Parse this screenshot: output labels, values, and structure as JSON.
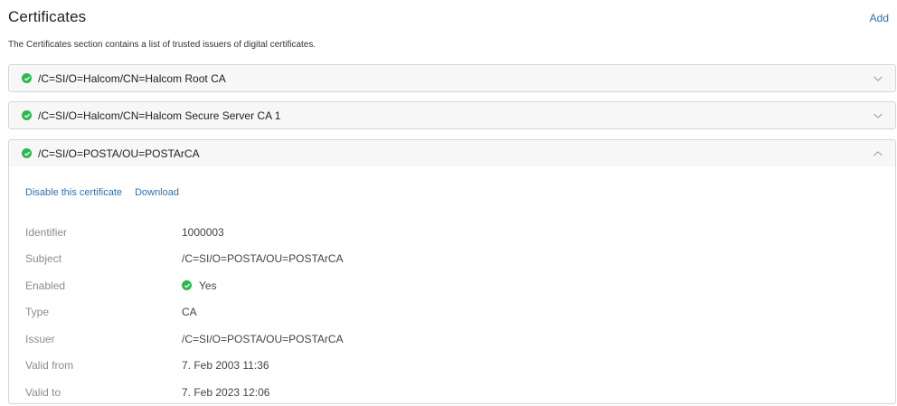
{
  "header": {
    "title": "Certificates",
    "add_label": "Add"
  },
  "description": "The Certificates section contains a list of trusted issuers of digital certificates.",
  "certificates": [
    {
      "name": "/C=SI/O=Halcom/CN=Halcom Root CA",
      "expanded": false
    },
    {
      "name": "/C=SI/O=Halcom/CN=Halcom Secure Server CA 1",
      "expanded": false
    },
    {
      "name": "/C=SI/O=POSTA/OU=POSTArCA",
      "expanded": true
    }
  ],
  "details": {
    "disable_label": "Disable this certificate",
    "download_label": "Download",
    "fields": [
      {
        "key": "Identifier",
        "value": "1000003"
      },
      {
        "key": "Subject",
        "value": "/C=SI/O=POSTA/OU=POSTArCA"
      },
      {
        "key": "Enabled",
        "value": "Yes"
      },
      {
        "key": "Type",
        "value": "CA"
      },
      {
        "key": "Issuer",
        "value": "/C=SI/O=POSTA/OU=POSTArCA"
      },
      {
        "key": "Valid from",
        "value": "7. Feb 2003 11:36"
      },
      {
        "key": "Valid to",
        "value": "7. Feb 2023 12:06"
      }
    ]
  },
  "colors": {
    "accent": "#2d6fb3",
    "success": "#2db84d"
  },
  "icons": {
    "status": "check-circle-icon",
    "collapsed": "chevron-down-icon",
    "expanded": "chevron-up-icon"
  }
}
